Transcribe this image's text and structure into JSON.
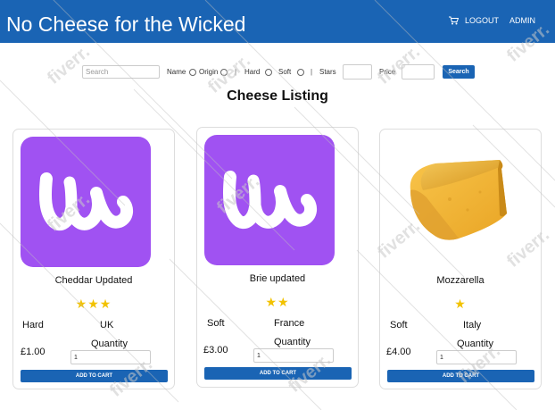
{
  "header": {
    "title": "No Cheese for the Wicked",
    "logout_label": "LOGOUT",
    "admin_label": "ADMIN",
    "cart_icon": "cart-icon",
    "background_color": "#1a64b4"
  },
  "filters": {
    "search_placeholder": "Search",
    "name_label": "Name",
    "origin_label": "Origin",
    "separator": "|",
    "hard_label": "Hard",
    "soft_label": "Soft",
    "stars_label": "Stars",
    "price_label": "Price",
    "search_button": "Search"
  },
  "page_title": "Cheese Listing",
  "products": [
    {
      "name": "Cheddar Updated",
      "stars": "★★★",
      "type": "Hard",
      "origin": "UK",
      "price": "£1.00",
      "quantity_label": "Quantity",
      "quantity": "1",
      "add_to_cart": "ADD TO CART",
      "image": "logo-icon"
    },
    {
      "name": "Brie updated",
      "stars": "★★",
      "type": "Soft",
      "origin": "France",
      "price": "£3.00",
      "quantity_label": "Quantity",
      "quantity": "1",
      "add_to_cart": "ADD TO CART",
      "image": "logo-icon"
    },
    {
      "name": "Mozzarella",
      "stars": "★",
      "type": "Soft",
      "origin": "Italy",
      "price": "£4.00",
      "quantity_label": "Quantity",
      "quantity": "1",
      "add_to_cart": "ADD TO CART",
      "image": "cheese-wedge-photo"
    }
  ],
  "watermark_text": "fiverr."
}
